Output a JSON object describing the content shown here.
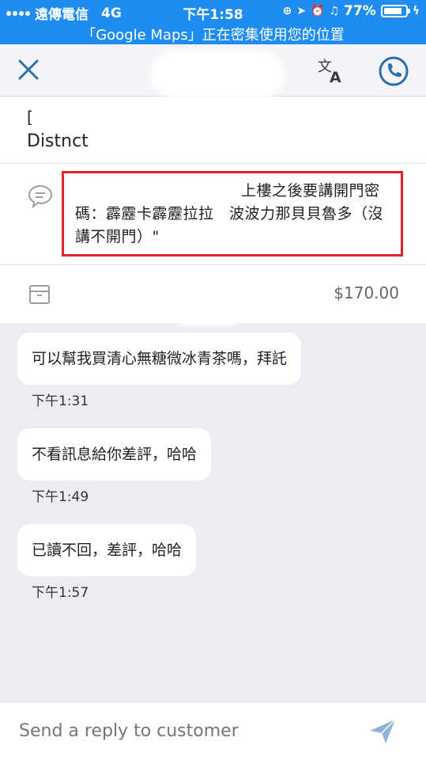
{
  "status_bar": {
    "carrier": "遠傳電信",
    "network": "4G",
    "time": "下午1:58",
    "battery": "77%",
    "location_banner": "「Google Maps」正在密集使用您的位置"
  },
  "header": {
    "close_icon": "close-icon",
    "translate_icon": "translate-icon",
    "call_icon": "phone-icon"
  },
  "info": {
    "address_line1": "[",
    "address_line2": "Distnct",
    "note": "上樓之後要講開門密碼：霹靂卡霹靂拉拉　波波力那貝貝魯多（沒講不開門）\"",
    "order_price": "$170.00"
  },
  "messages": [
    {
      "text": "可以幫我買清心無糖微冰青茶嗎，拜託",
      "time": "下午1:31"
    },
    {
      "text": "不看訊息給你差評，哈哈",
      "time": "下午1:49"
    },
    {
      "text": "已讀不回，差評，哈哈",
      "time": "下午1:57"
    }
  ],
  "reply": {
    "placeholder": "Send a reply to customer",
    "send_icon": "send-icon"
  },
  "colors": {
    "status_bar": "#1e8cf0",
    "accent": "#2d6ea8",
    "highlight_box": "#e0232a",
    "background": "#ecedf2"
  }
}
